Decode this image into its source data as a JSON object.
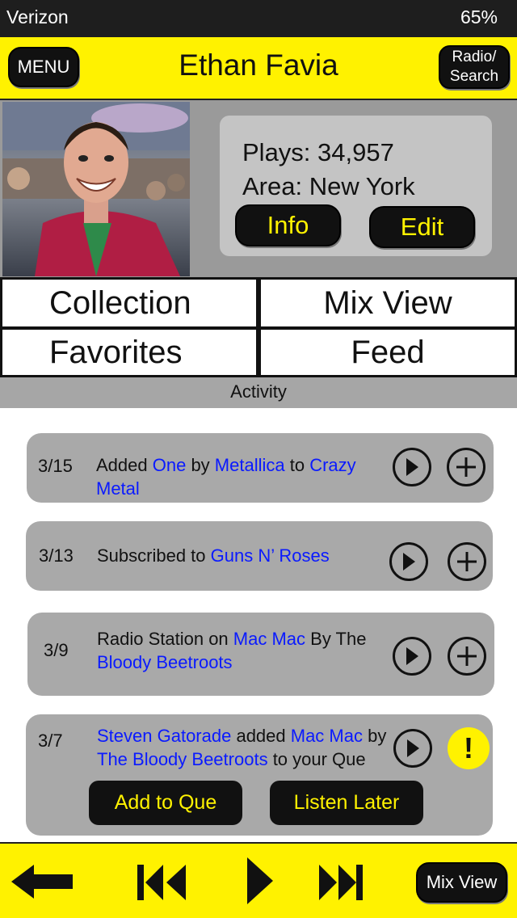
{
  "status_bar": {
    "carrier": "Verizon",
    "battery": "65%"
  },
  "header": {
    "menu_label": "MENU",
    "title": "Ethan Favia",
    "radio_search_line1": "Radio/",
    "radio_search_line2": "Search"
  },
  "profile": {
    "plays_label": "Plays: 34,957",
    "area_label": "Area: New York",
    "info_label": "Info",
    "edit_label": "Edit"
  },
  "nav": {
    "collection": "Collection",
    "mix_view": "Mix View",
    "favorites": "Favorites",
    "feed": "Feed"
  },
  "activity": {
    "heading": "Activity",
    "items": [
      {
        "date": "3/15",
        "t1": "Added ",
        "l1": "One",
        "t2": " by ",
        "l2": "Metallica",
        "t3": " to ",
        "l3": "Crazy",
        "l4": "Metal"
      },
      {
        "date": "3/13",
        "t1": "Subscribed to ",
        "l1": "Guns N’ Roses"
      },
      {
        "date": "3/9",
        "t1": "Radio Station on ",
        "l1": "Mac Mac",
        "t2": " By The",
        "l2": "Bloody Beetroots"
      },
      {
        "date": "3/7",
        "l1": "Steven Gatorade",
        "t1": " added ",
        "l2": "Mac Mac",
        "t2": "  by",
        "l3": "The Bloody Beetroots",
        "t3": " to your  Que",
        "add_to_que": "Add to Que",
        "listen_later": "Listen Later",
        "alert_symbol": "!"
      }
    ]
  },
  "player": {
    "mix_view_label": "Mix View"
  },
  "colors": {
    "accent_yellow": "#fff200",
    "link_blue": "#0a1aff",
    "panel_gray": "#9a9a9a"
  }
}
